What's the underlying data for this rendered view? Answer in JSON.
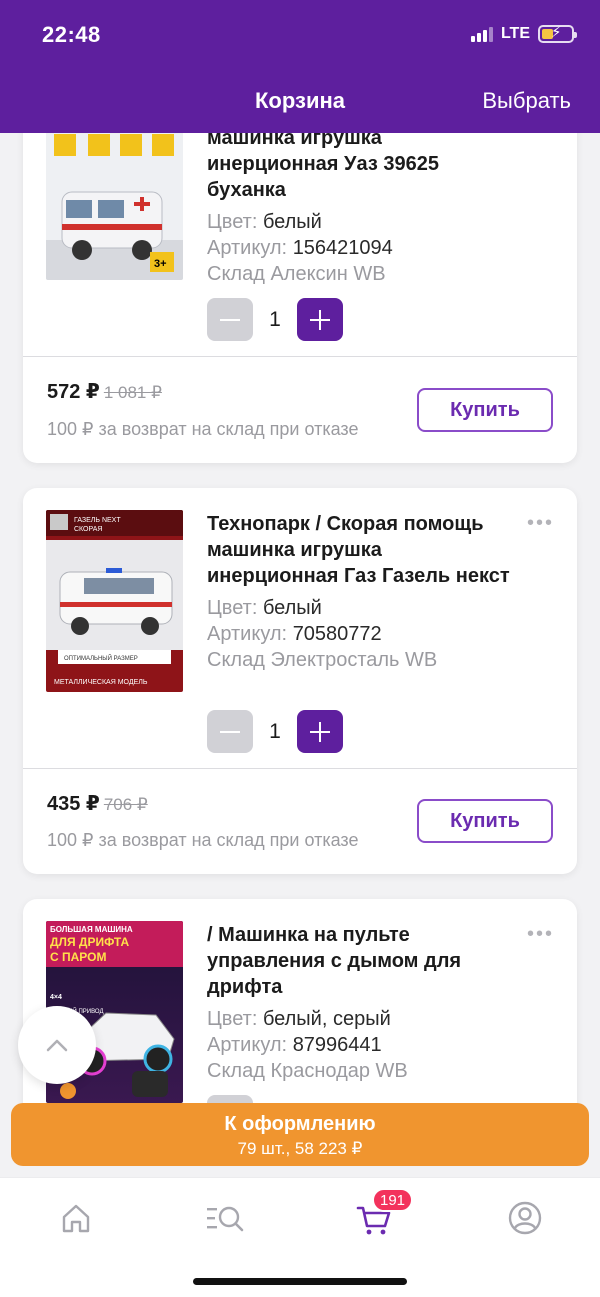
{
  "status": {
    "time": "22:48",
    "network": "LTE"
  },
  "header": {
    "title": "Корзина",
    "select_label": "Выбрать"
  },
  "items": [
    {
      "name_visible": "машинка игрушка инерционная Уаз 39625 буханка",
      "color_label": "Цвет:",
      "color_value": "белый",
      "article_label": "Артикул:",
      "article_value": "156421094",
      "warehouse": "Склад Алексин WB",
      "qty": "1",
      "price": "572 ₽",
      "old_price": "1 081 ₽",
      "refund_note": "100 ₽ за возврат на склад при отказе",
      "buy_label": "Купить"
    },
    {
      "name_visible": "Технопарк / Скорая помощь машинка игрушка инерционная Газ Газель некст",
      "color_label": "Цвет:",
      "color_value": "белый",
      "article_label": "Артикул:",
      "article_value": "70580772",
      "warehouse": "Склад Электросталь WB",
      "qty": "1",
      "price": "435 ₽",
      "old_price": "706 ₽",
      "refund_note": "100 ₽ за возврат на склад при отказе",
      "buy_label": "Купить",
      "thumb_text": {
        "t1": "ГАЗЕЛЬ NEXT",
        "t2": "СКОРАЯ",
        "t3": "ОПТИМАЛЬНЫЙ РАЗМЕР",
        "t4": "МЕТАЛЛИЧЕСКАЯ МОДЕЛЬ"
      }
    },
    {
      "name_visible": " / Машинка на пульте управления с дымом для дрифта",
      "color_label": "Цвет:",
      "color_value": "белый, серый",
      "article_label": "Артикул:",
      "article_value": "87996441",
      "warehouse": "Склад Краснодар WB",
      "thumb_text": {
        "t1": "БОЛЬШАЯ МАШИНА",
        "t2": "ДЛЯ ДРИФТА",
        "t3": "С ПАРОМ",
        "t4": "ПОЛНЫЙ ПРИВОД",
        "t5": "4×4"
      }
    }
  ],
  "checkout": {
    "label": "К оформлению",
    "summary": "79 шт., 58 223 ₽"
  },
  "tabbar": {
    "cart_badge": "191"
  },
  "colors": {
    "brand": "#5e1f9e",
    "checkout": "#f0952f",
    "badge": "#f3325c"
  }
}
